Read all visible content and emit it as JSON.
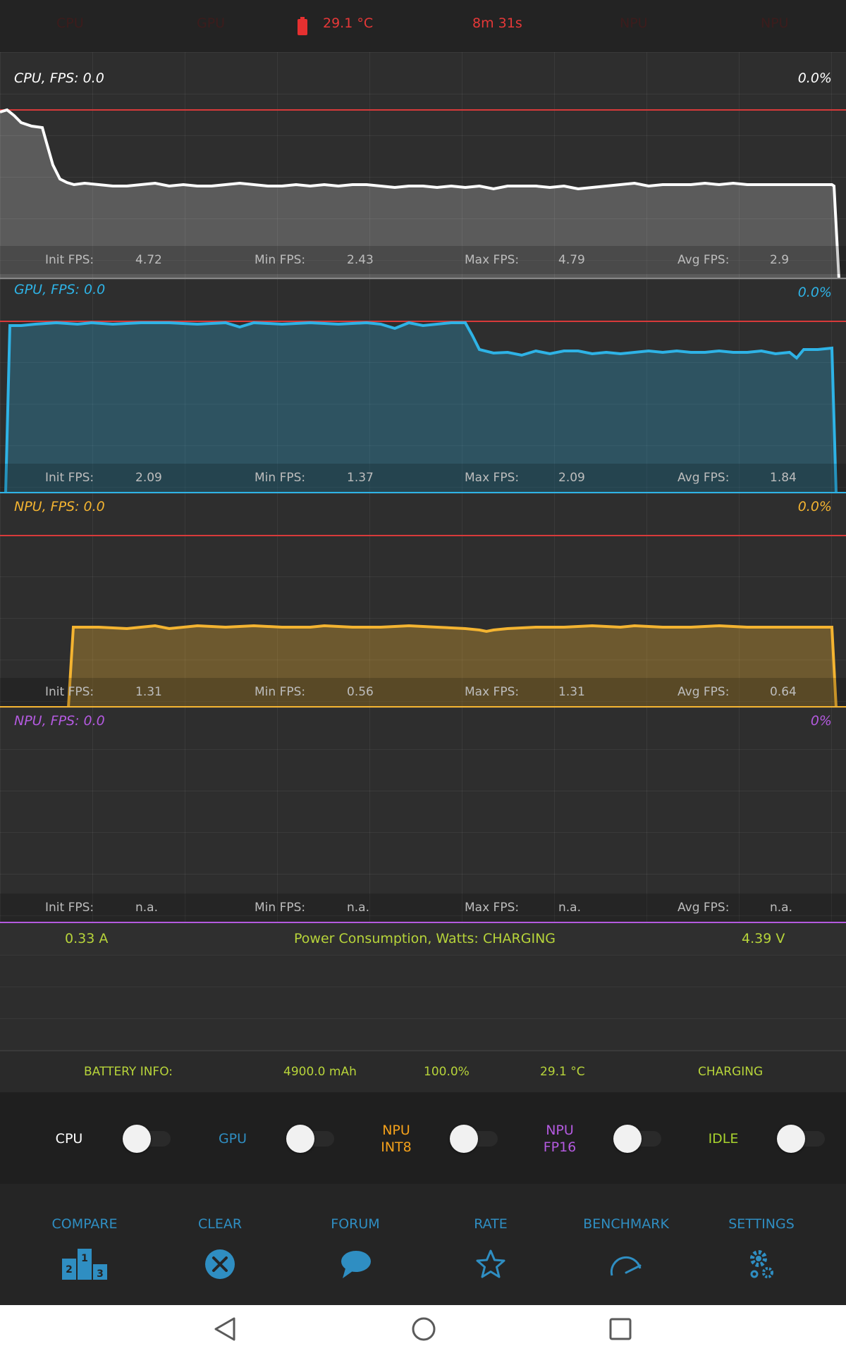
{
  "top_bar": {
    "cpu": "CPU",
    "gpu": "GPU",
    "battery_icon": "battery-icon",
    "temperature": "29.1 °C",
    "timer": "8m 31s",
    "npu1": "NPU",
    "npu2": "NPU"
  },
  "panels": {
    "cpu": {
      "title": "CPU, FPS:  0.0",
      "percent": "0.0%",
      "init_label": "Init FPS:",
      "init": "4.72",
      "min_label": "Min FPS:",
      "min": "2.43",
      "max_label": "Max FPS:",
      "max": "4.79",
      "avg_label": "Avg FPS:",
      "avg": "2.9",
      "color": "#ffffff"
    },
    "gpu": {
      "title": "GPU, FPS:  0.0",
      "percent": "0.0%",
      "init_label": "Init FPS:",
      "init": "2.09",
      "min_label": "Min FPS:",
      "min": "1.37",
      "max_label": "Max FPS:",
      "max": "2.09",
      "avg_label": "Avg FPS:",
      "avg": "1.84",
      "color": "#2eb3e6"
    },
    "npu_int8": {
      "title": "NPU, FPS:  0.0",
      "percent": "0.0%",
      "init_label": "Init FPS:",
      "init": "1.31",
      "min_label": "Min FPS:",
      "min": "0.56",
      "max_label": "Max FPS:",
      "max": "1.31",
      "avg_label": "Avg FPS:",
      "avg": "0.64",
      "color": "#f4b431"
    },
    "npu_fp16": {
      "title": "NPU, FPS:  0.0",
      "percent": "0%",
      "init_label": "Init FPS:",
      "init": "n.a.",
      "min_label": "Min FPS:",
      "min": "n.a.",
      "max_label": "Max FPS:",
      "max": "n.a.",
      "avg_label": "Avg FPS:",
      "avg": "n.a.",
      "color": "#b45ae0"
    }
  },
  "power": {
    "current": "0.33 A",
    "label": "Power Consumption, Watts:",
    "status": "CHARGING",
    "voltage": "4.39 V"
  },
  "battery": {
    "label": "BATTERY INFO:",
    "capacity": "4900.0 mAh",
    "level": "100.0%",
    "temperature": "29.1 °C",
    "status": "CHARGING"
  },
  "toggles": [
    {
      "label_line1": "CPU",
      "label_line2": "",
      "color": "#ffffff"
    },
    {
      "label_line1": "GPU",
      "label_line2": "",
      "color": "#2f8ec2"
    },
    {
      "label_line1": "NPU",
      "label_line2": "INT8",
      "color": "#f4a11b"
    },
    {
      "label_line1": "NPU",
      "label_line2": "FP16",
      "color": "#b45ae0"
    },
    {
      "label_line1": "IDLE",
      "label_line2": "",
      "color": "#a8d32e"
    }
  ],
  "actions": [
    {
      "label": "COMPARE",
      "icon": "podium-icon"
    },
    {
      "label": "CLEAR",
      "icon": "clear-x-icon"
    },
    {
      "label": "FORUM",
      "icon": "chat-bubble-icon"
    },
    {
      "label": "RATE",
      "icon": "star-icon"
    },
    {
      "label": "BENCHMARK",
      "icon": "gauge-icon"
    },
    {
      "label": "SETTINGS",
      "icon": "gear-icon"
    }
  ],
  "navbar": {
    "back": "back-icon",
    "home": "home-icon",
    "recents": "recents-icon"
  }
}
